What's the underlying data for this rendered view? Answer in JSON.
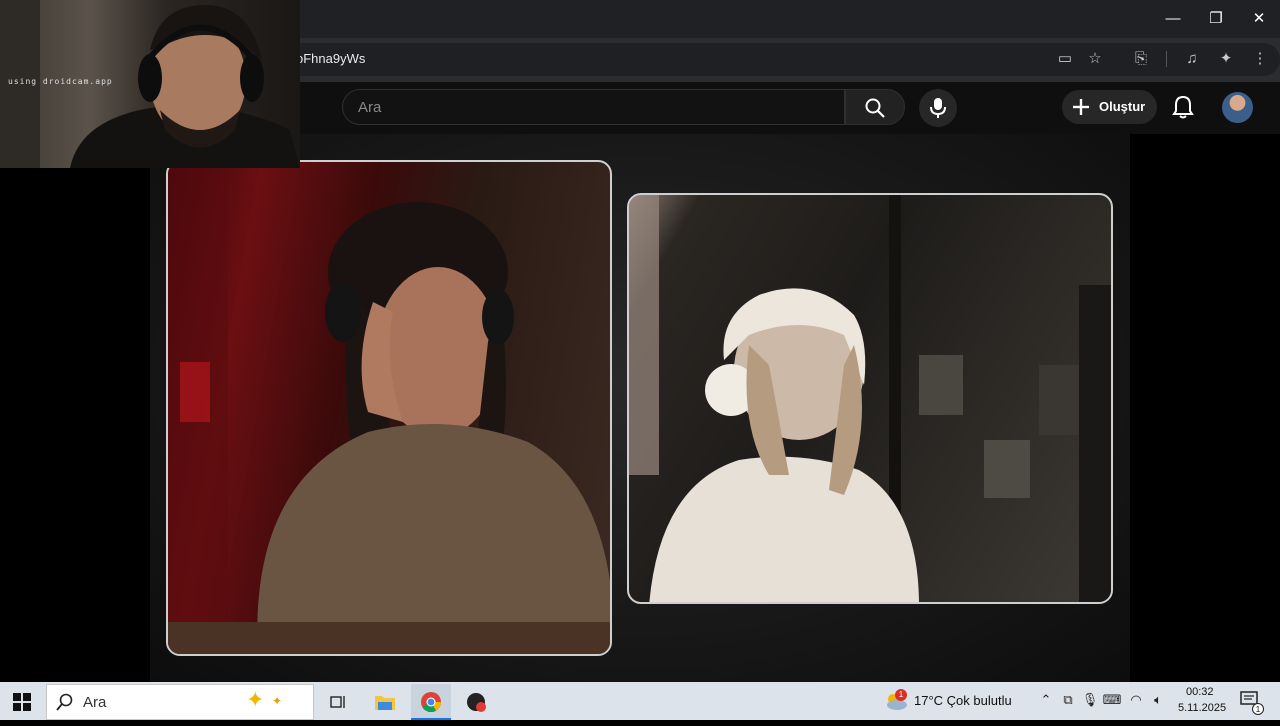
{
  "browser": {
    "url_fragment": "oFhna9yWs",
    "window_controls": {
      "minimize": "—",
      "restore": "❐",
      "close": "✕"
    },
    "toolbar_icons": [
      "cast-icon",
      "bookmark-star-icon",
      "translate-icon",
      "media-control-icon",
      "extensions-icon",
      "more-menu-icon"
    ]
  },
  "youtube": {
    "search_placeholder": "Ara",
    "create_label": "Oluştur"
  },
  "webcam": {
    "overlay_text": "using droidcam.app"
  },
  "taskbar": {
    "search_placeholder": "Ara",
    "weather": {
      "badge": "1",
      "text": "17°C  Çok bulutlu"
    },
    "clock": {
      "time": "00:32",
      "date": "5.11.2025"
    },
    "notification_badge": "1"
  },
  "colors": {
    "chrome_bg": "#202124",
    "youtube_bg": "#0f0f0f",
    "taskbar_bg": "#dde3ea",
    "panel_border": "#cfcfcf"
  }
}
